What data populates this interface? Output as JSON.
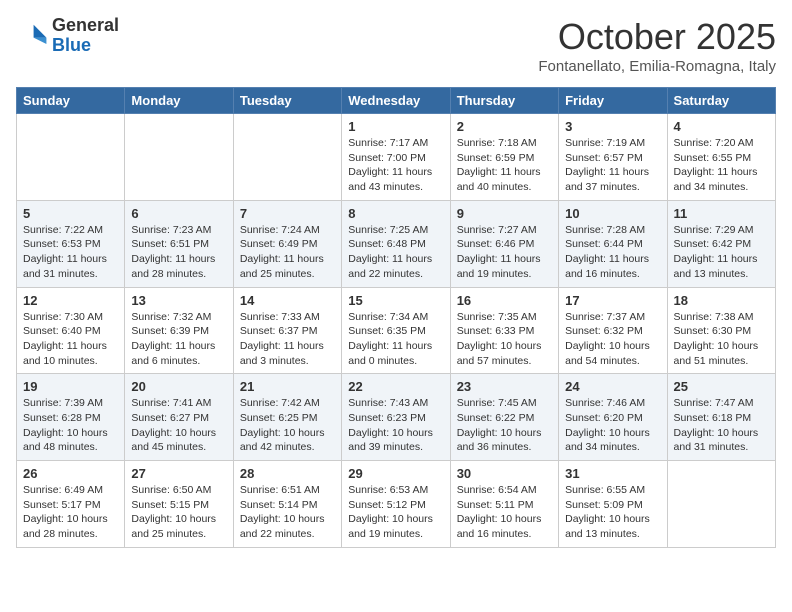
{
  "header": {
    "logo_general": "General",
    "logo_blue": "Blue",
    "month_title": "October 2025",
    "location": "Fontanellato, Emilia-Romagna, Italy"
  },
  "days_of_week": [
    "Sunday",
    "Monday",
    "Tuesday",
    "Wednesday",
    "Thursday",
    "Friday",
    "Saturday"
  ],
  "weeks": [
    [
      {
        "day": "",
        "info": ""
      },
      {
        "day": "",
        "info": ""
      },
      {
        "day": "",
        "info": ""
      },
      {
        "day": "1",
        "info": "Sunrise: 7:17 AM\nSunset: 7:00 PM\nDaylight: 11 hours and 43 minutes."
      },
      {
        "day": "2",
        "info": "Sunrise: 7:18 AM\nSunset: 6:59 PM\nDaylight: 11 hours and 40 minutes."
      },
      {
        "day": "3",
        "info": "Sunrise: 7:19 AM\nSunset: 6:57 PM\nDaylight: 11 hours and 37 minutes."
      },
      {
        "day": "4",
        "info": "Sunrise: 7:20 AM\nSunset: 6:55 PM\nDaylight: 11 hours and 34 minutes."
      }
    ],
    [
      {
        "day": "5",
        "info": "Sunrise: 7:22 AM\nSunset: 6:53 PM\nDaylight: 11 hours and 31 minutes."
      },
      {
        "day": "6",
        "info": "Sunrise: 7:23 AM\nSunset: 6:51 PM\nDaylight: 11 hours and 28 minutes."
      },
      {
        "day": "7",
        "info": "Sunrise: 7:24 AM\nSunset: 6:49 PM\nDaylight: 11 hours and 25 minutes."
      },
      {
        "day": "8",
        "info": "Sunrise: 7:25 AM\nSunset: 6:48 PM\nDaylight: 11 hours and 22 minutes."
      },
      {
        "day": "9",
        "info": "Sunrise: 7:27 AM\nSunset: 6:46 PM\nDaylight: 11 hours and 19 minutes."
      },
      {
        "day": "10",
        "info": "Sunrise: 7:28 AM\nSunset: 6:44 PM\nDaylight: 11 hours and 16 minutes."
      },
      {
        "day": "11",
        "info": "Sunrise: 7:29 AM\nSunset: 6:42 PM\nDaylight: 11 hours and 13 minutes."
      }
    ],
    [
      {
        "day": "12",
        "info": "Sunrise: 7:30 AM\nSunset: 6:40 PM\nDaylight: 11 hours and 10 minutes."
      },
      {
        "day": "13",
        "info": "Sunrise: 7:32 AM\nSunset: 6:39 PM\nDaylight: 11 hours and 6 minutes."
      },
      {
        "day": "14",
        "info": "Sunrise: 7:33 AM\nSunset: 6:37 PM\nDaylight: 11 hours and 3 minutes."
      },
      {
        "day": "15",
        "info": "Sunrise: 7:34 AM\nSunset: 6:35 PM\nDaylight: 11 hours and 0 minutes."
      },
      {
        "day": "16",
        "info": "Sunrise: 7:35 AM\nSunset: 6:33 PM\nDaylight: 10 hours and 57 minutes."
      },
      {
        "day": "17",
        "info": "Sunrise: 7:37 AM\nSunset: 6:32 PM\nDaylight: 10 hours and 54 minutes."
      },
      {
        "day": "18",
        "info": "Sunrise: 7:38 AM\nSunset: 6:30 PM\nDaylight: 10 hours and 51 minutes."
      }
    ],
    [
      {
        "day": "19",
        "info": "Sunrise: 7:39 AM\nSunset: 6:28 PM\nDaylight: 10 hours and 48 minutes."
      },
      {
        "day": "20",
        "info": "Sunrise: 7:41 AM\nSunset: 6:27 PM\nDaylight: 10 hours and 45 minutes."
      },
      {
        "day": "21",
        "info": "Sunrise: 7:42 AM\nSunset: 6:25 PM\nDaylight: 10 hours and 42 minutes."
      },
      {
        "day": "22",
        "info": "Sunrise: 7:43 AM\nSunset: 6:23 PM\nDaylight: 10 hours and 39 minutes."
      },
      {
        "day": "23",
        "info": "Sunrise: 7:45 AM\nSunset: 6:22 PM\nDaylight: 10 hours and 36 minutes."
      },
      {
        "day": "24",
        "info": "Sunrise: 7:46 AM\nSunset: 6:20 PM\nDaylight: 10 hours and 34 minutes."
      },
      {
        "day": "25",
        "info": "Sunrise: 7:47 AM\nSunset: 6:18 PM\nDaylight: 10 hours and 31 minutes."
      }
    ],
    [
      {
        "day": "26",
        "info": "Sunrise: 6:49 AM\nSunset: 5:17 PM\nDaylight: 10 hours and 28 minutes."
      },
      {
        "day": "27",
        "info": "Sunrise: 6:50 AM\nSunset: 5:15 PM\nDaylight: 10 hours and 25 minutes."
      },
      {
        "day": "28",
        "info": "Sunrise: 6:51 AM\nSunset: 5:14 PM\nDaylight: 10 hours and 22 minutes."
      },
      {
        "day": "29",
        "info": "Sunrise: 6:53 AM\nSunset: 5:12 PM\nDaylight: 10 hours and 19 minutes."
      },
      {
        "day": "30",
        "info": "Sunrise: 6:54 AM\nSunset: 5:11 PM\nDaylight: 10 hours and 16 minutes."
      },
      {
        "day": "31",
        "info": "Sunrise: 6:55 AM\nSunset: 5:09 PM\nDaylight: 10 hours and 13 minutes."
      },
      {
        "day": "",
        "info": ""
      }
    ]
  ]
}
